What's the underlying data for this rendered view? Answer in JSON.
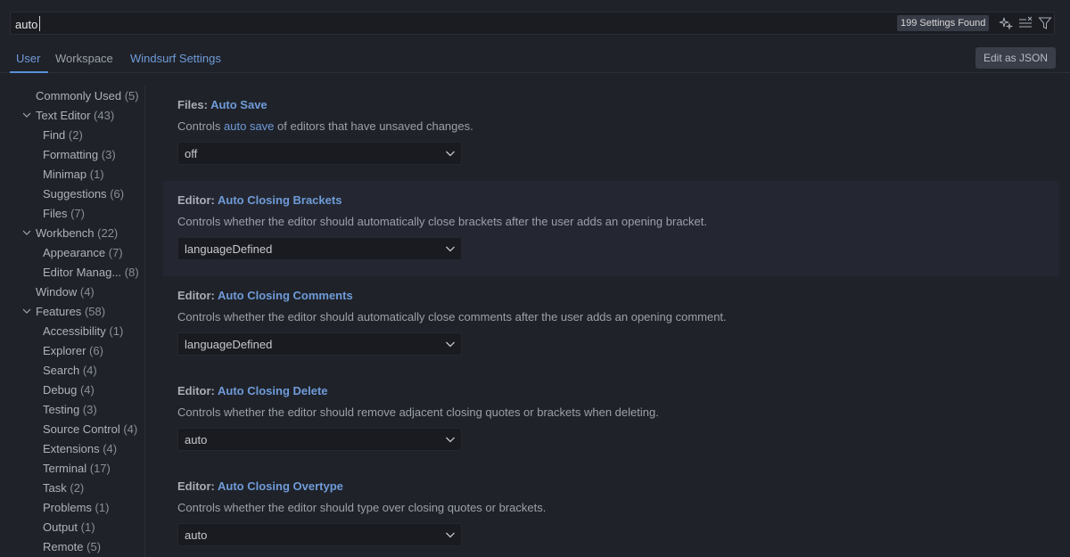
{
  "search": {
    "value": "auto",
    "found": "199 Settings Found"
  },
  "tabs": [
    {
      "label": "User"
    },
    {
      "label": "Workspace"
    },
    {
      "label": "Windsurf Settings"
    }
  ],
  "edit_json_label": "Edit as JSON",
  "toc": [
    {
      "label": "Commonly Used",
      "count": "(5)"
    },
    {
      "label": "Text Editor",
      "count": "(43)"
    },
    {
      "label": "Find",
      "count": "(2)"
    },
    {
      "label": "Formatting",
      "count": "(3)"
    },
    {
      "label": "Minimap",
      "count": "(1)"
    },
    {
      "label": "Suggestions",
      "count": "(6)"
    },
    {
      "label": "Files",
      "count": "(7)"
    },
    {
      "label": "Workbench",
      "count": "(22)"
    },
    {
      "label": "Appearance",
      "count": "(7)"
    },
    {
      "label": "Editor Manag...",
      "count": "(8)"
    },
    {
      "label": "Window",
      "count": "(4)"
    },
    {
      "label": "Features",
      "count": "(58)"
    },
    {
      "label": "Accessibility",
      "count": "(1)"
    },
    {
      "label": "Explorer",
      "count": "(6)"
    },
    {
      "label": "Search",
      "count": "(4)"
    },
    {
      "label": "Debug",
      "count": "(4)"
    },
    {
      "label": "Testing",
      "count": "(3)"
    },
    {
      "label": "Source Control",
      "count": "(4)"
    },
    {
      "label": "Extensions",
      "count": "(4)"
    },
    {
      "label": "Terminal",
      "count": "(17)"
    },
    {
      "label": "Task",
      "count": "(2)"
    },
    {
      "label": "Problems",
      "count": "(1)"
    },
    {
      "label": "Output",
      "count": "(1)"
    },
    {
      "label": "Remote",
      "count": "(5)"
    }
  ],
  "settings": [
    {
      "category": "Files: ",
      "name": "Auto Save",
      "desc_before": "Controls ",
      "desc_hl": "auto save",
      "desc_after": " of editors that have unsaved changes.",
      "value": "off"
    },
    {
      "category": "Editor: ",
      "name": "Auto Closing Brackets",
      "desc_before": "Controls whether the editor should automatically close brackets after the user adds an opening bracket.",
      "desc_hl": "",
      "desc_after": "",
      "value": "languageDefined"
    },
    {
      "category": "Editor: ",
      "name": "Auto Closing Comments",
      "desc_before": "Controls whether the editor should automatically close comments after the user adds an opening comment.",
      "desc_hl": "",
      "desc_after": "",
      "value": "languageDefined"
    },
    {
      "category": "Editor: ",
      "name": "Auto Closing Delete",
      "desc_before": "Controls whether the editor should remove adjacent closing quotes or brackets when deleting.",
      "desc_hl": "",
      "desc_after": "",
      "value": "auto"
    },
    {
      "category": "Editor: ",
      "name": "Auto Closing Overtype",
      "desc_before": "Controls whether the editor should type over closing quotes or brackets.",
      "desc_hl": "",
      "desc_after": "",
      "value": "auto"
    }
  ]
}
